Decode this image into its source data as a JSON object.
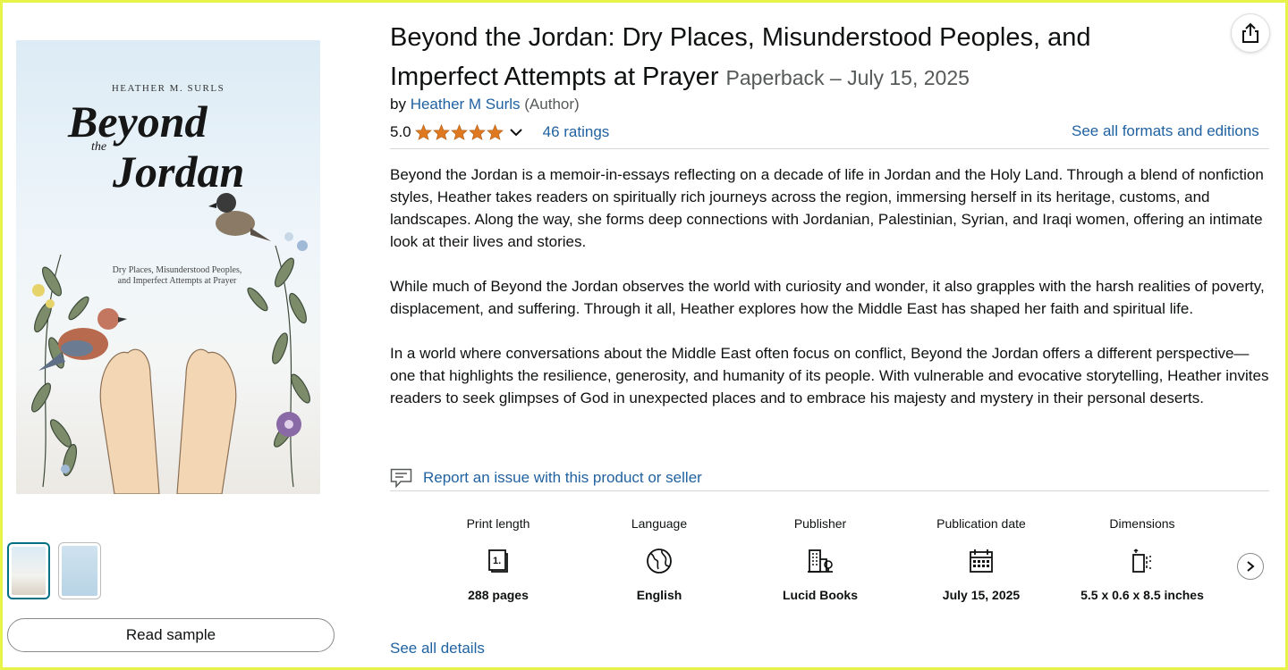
{
  "cover": {
    "author": "HEATHER M. SURLS",
    "title_line1": "Beyond",
    "title_the": "the",
    "title_line2": "Jordan",
    "subtitle": "Dry Places, Misunderstood Peoples, and Imperfect Attempts at Prayer"
  },
  "gallery": {
    "read_sample_label": "Read sample"
  },
  "product": {
    "title": "Beyond the Jordan: Dry Places, Misunderstood Peoples, and Imperfect Attempts at Prayer",
    "format": "Paperback – July 15, 2025",
    "by": "by",
    "author": "Heather M Surls",
    "author_role": "(Author)",
    "rating": "5.0",
    "stars": 5,
    "ratings_count": "46 ratings",
    "formats_link": "See all formats and editions"
  },
  "description": {
    "paragraphs": [
      "Beyond the Jordan is a memoir-in-essays reflecting on a decade of life in Jordan and the Holy Land. Through a blend of nonfiction styles, Heather takes readers on spiritually rich journeys across the region, immersing herself in its heritage, customs, and landscapes. Along the way, she forms deep connections with Jordanian, Palestinian, Syrian, and Iraqi women, offering an intimate look at their lives and stories.",
      "While much of Beyond the Jordan observes the world with curiosity and wonder, it also grapples with the harsh realities of poverty, displacement, and suffering. Through it all, Heather explores how the Middle East has shaped her faith and spiritual life.",
      "In a world where conversations about the Middle East often focus on conflict, Beyond the Jordan offers a different perspective—one that highlights the resilience, generosity, and humanity of its people. With vulnerable and evocative storytelling, Heather invites readers to seek glimpses of God in unexpected places and to embrace his majesty and mystery in their personal deserts."
    ]
  },
  "report_link": "Report an issue with this product or seller",
  "details": [
    {
      "label": "Print length",
      "value": "288 pages",
      "icon": "book-pages-icon"
    },
    {
      "label": "Language",
      "value": "English",
      "icon": "globe-icon"
    },
    {
      "label": "Publisher",
      "value": "Lucid Books",
      "icon": "building-icon"
    },
    {
      "label": "Publication date",
      "value": "July 15, 2025",
      "icon": "calendar-icon"
    },
    {
      "label": "Dimensions",
      "value": "5.5 x 0.6 x 8.5 inches",
      "icon": "dimensions-icon"
    }
  ],
  "see_all_details": "See all details",
  "colors": {
    "link": "#2162a1",
    "star": "#de7921",
    "frame": "#e8f34a",
    "selected_thumb": "#007185"
  }
}
